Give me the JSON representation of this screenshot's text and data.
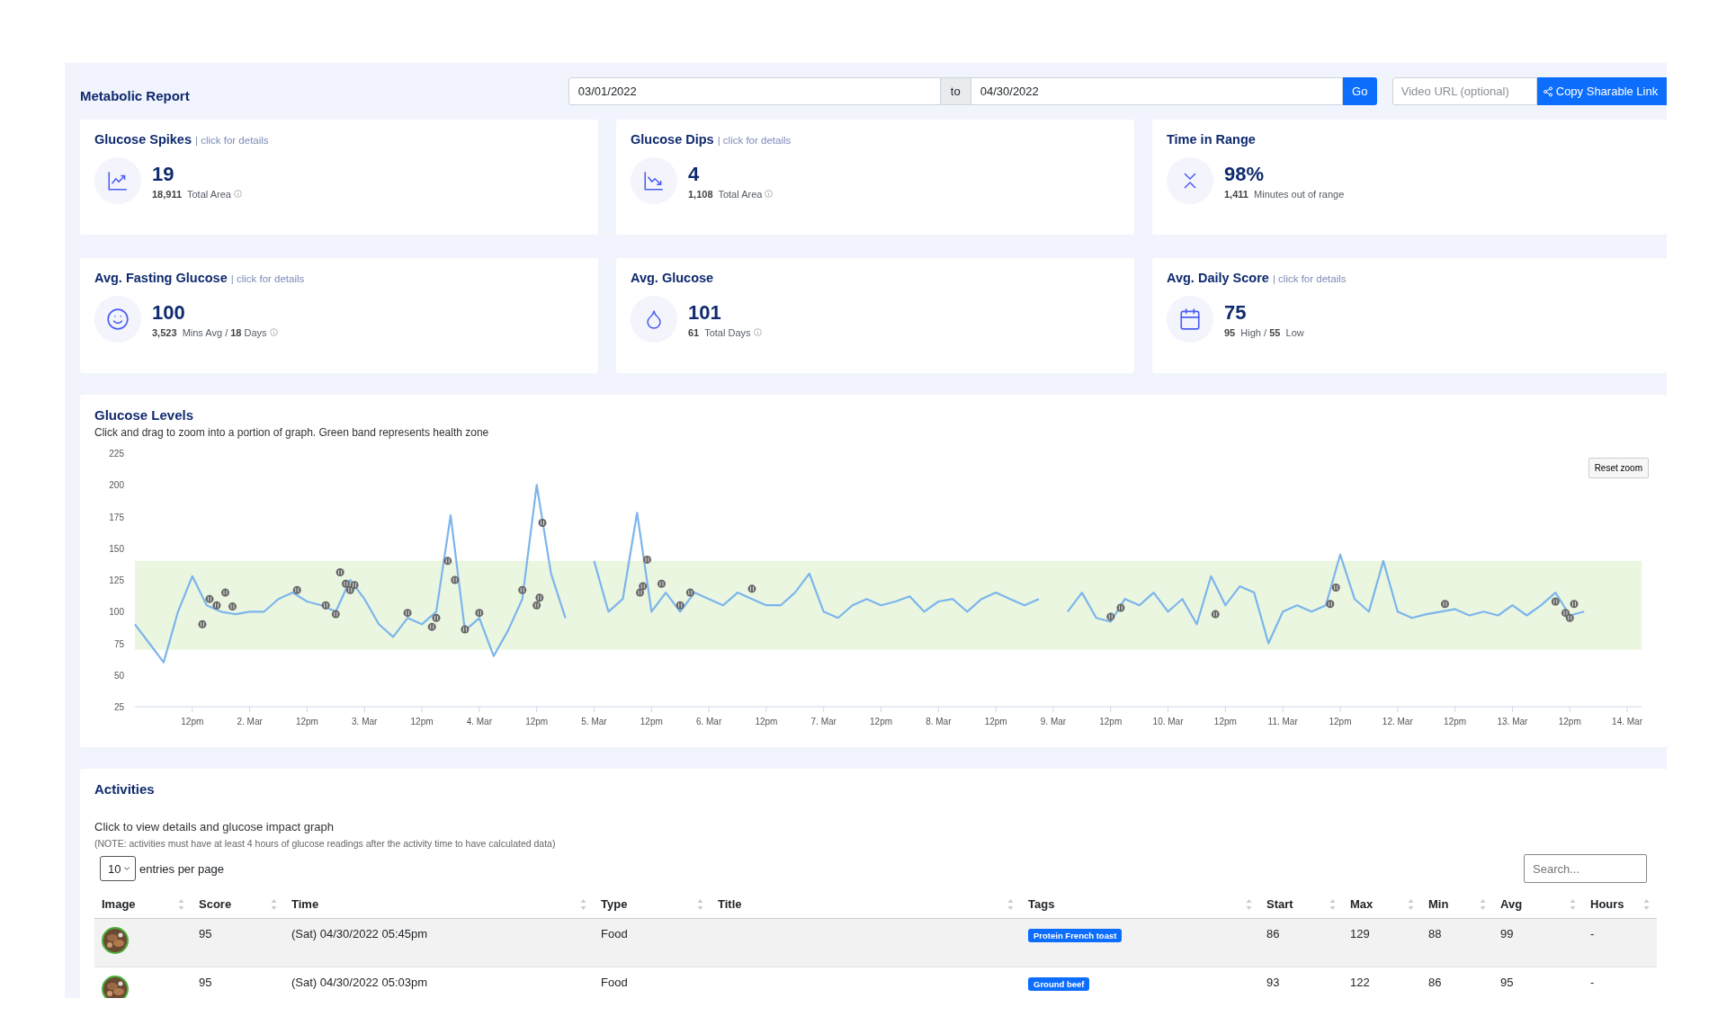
{
  "header": {
    "title": "Metabolic Report",
    "date_from": "03/01/2022",
    "date_separator": "to",
    "date_to": "04/30/2022",
    "go_button": "Go",
    "video_url": {
      "placeholder": "Video URL (optional)"
    },
    "share_button": "Copy Sharable Link"
  },
  "stat_cards": [
    {
      "title": "Glucose Spikes",
      "link": "| click for details",
      "value": "19",
      "detail": "**18,911**  Total Area",
      "info": true
    },
    {
      "title": "Glucose Dips",
      "link": "| click for details",
      "value": "4",
      "detail": "**1,108**  Total Area",
      "info": true
    },
    {
      "title": "Time in Range",
      "value": "98%",
      "detail": "**1,411**  Minutes out of range",
      "info": false
    },
    {
      "title": "Avg. Fasting Glucose",
      "link": "| click for details",
      "value": "100",
      "detail": "**3,523**  Mins Avg / **18** Days",
      "info": true
    },
    {
      "title": "Avg. Glucose",
      "value": "101",
      "detail": "**61**  Total Days",
      "info": true
    },
    {
      "title": "Avg. Daily Score",
      "link": "| click for details",
      "value": "75",
      "detail": "**95**  High / **55**  Low",
      "info": false
    }
  ],
  "glucose": {
    "title": "Glucose Levels",
    "subtitle": "Click and drag to zoom into a portion of graph. Green band represents health zone",
    "reset_button": "Reset zoom",
    "chart_data": {
      "type": "line",
      "ylim": [
        25,
        225
      ],
      "yticks": [
        25,
        50,
        75,
        100,
        125,
        150,
        175,
        200,
        225
      ],
      "categories": [
        null,
        null,
        null,
        null,
        "12pm",
        null,
        null,
        null,
        "2. Mar",
        null,
        null,
        null,
        "12pm",
        null,
        null,
        null,
        "3. Mar",
        null,
        null,
        null,
        "12pm",
        null,
        null,
        null,
        "4. Mar",
        null,
        null,
        null,
        "12pm",
        null,
        null,
        null,
        "5. Mar",
        null,
        null,
        null,
        "12pm",
        null,
        null,
        null,
        "6. Mar",
        null,
        null,
        null,
        "12pm",
        null,
        null,
        null,
        "7. Mar",
        null,
        null,
        null,
        "12pm",
        null,
        null,
        null,
        "8. Mar",
        null,
        null,
        null,
        "12pm",
        null,
        null,
        null,
        "9. Mar",
        null,
        null,
        null,
        "12pm",
        null,
        null,
        null,
        "10. Mar",
        null,
        null,
        null,
        "12pm",
        null,
        null,
        null,
        "11. Mar",
        null,
        null,
        null,
        "12pm",
        null,
        null,
        null,
        "12. Mar",
        null,
        null,
        null,
        "12pm",
        null,
        null,
        null,
        "13. Mar",
        null,
        null,
        null,
        "12pm",
        null,
        null,
        null,
        "14. Mar",
        null
      ],
      "series": [
        {
          "color": "#7cb5ec",
          "values": [
            90,
            75,
            60,
            100,
            128,
            105,
            100,
            98,
            100,
            100,
            110,
            115,
            108,
            105,
            100,
            125,
            110,
            90,
            80,
            95,
            90,
            100,
            176,
            85,
            95,
            65,
            85,
            110,
            200,
            130,
            95,
            null,
            140,
            100,
            110,
            178,
            100,
            115,
            100,
            115,
            110,
            105,
            115,
            110,
            105,
            105,
            115,
            130,
            100,
            95,
            105,
            110,
            105,
            108,
            112,
            100,
            108,
            110,
            100,
            110,
            115,
            110,
            105,
            110,
            null,
            100,
            115,
            95,
            92,
            110,
            105,
            115,
            100,
            110,
            90,
            128,
            105,
            120,
            115,
            75,
            100,
            105,
            100,
            105,
            145,
            110,
            100,
            140,
            100,
            95,
            98,
            100,
            102,
            97,
            100,
            97,
            105,
            97,
            105,
            115,
            97,
            100,
            null,
            null,
            null,
            null
          ]
        }
      ],
      "relative": false,
      "bands": [
        {
          "axis": "y",
          "from": 70,
          "to": 140,
          "color": "#eaf6e0"
        }
      ]
    }
  },
  "activities": {
    "title": "Activities",
    "intro": "Click to view details and glucose impact graph",
    "note": "(NOTE: activities must have at least 4 hours of glucose readings after the activity time to have calculated data)",
    "page_size": "10",
    "page_size_label": "entries per page",
    "search": {
      "placeholder": "Search..."
    },
    "columns": [
      "Image",
      "Score",
      "Time",
      "Type",
      "Title",
      "Tags",
      "Start",
      "Max",
      "Min",
      "Avg",
      "Hours"
    ],
    "rows": [
      {
        "image": {
          "kind": "picture"
        },
        "score": "95",
        "time": "(Sat) 04/30/2022 05:45pm",
        "type": "Food",
        "tags": [
          "Protein French toast"
        ],
        "start": "86",
        "max": "129",
        "min": "88",
        "avg": "99",
        "hours": "-"
      },
      {
        "image": {
          "kind": "picture"
        },
        "score": "95",
        "time": "(Sat) 04/30/2022 05:03pm",
        "type": "Food",
        "tags": [
          "Ground beef"
        ],
        "start": "93",
        "max": "122",
        "min": "86",
        "avg": "95",
        "hours": "-"
      }
    ]
  }
}
